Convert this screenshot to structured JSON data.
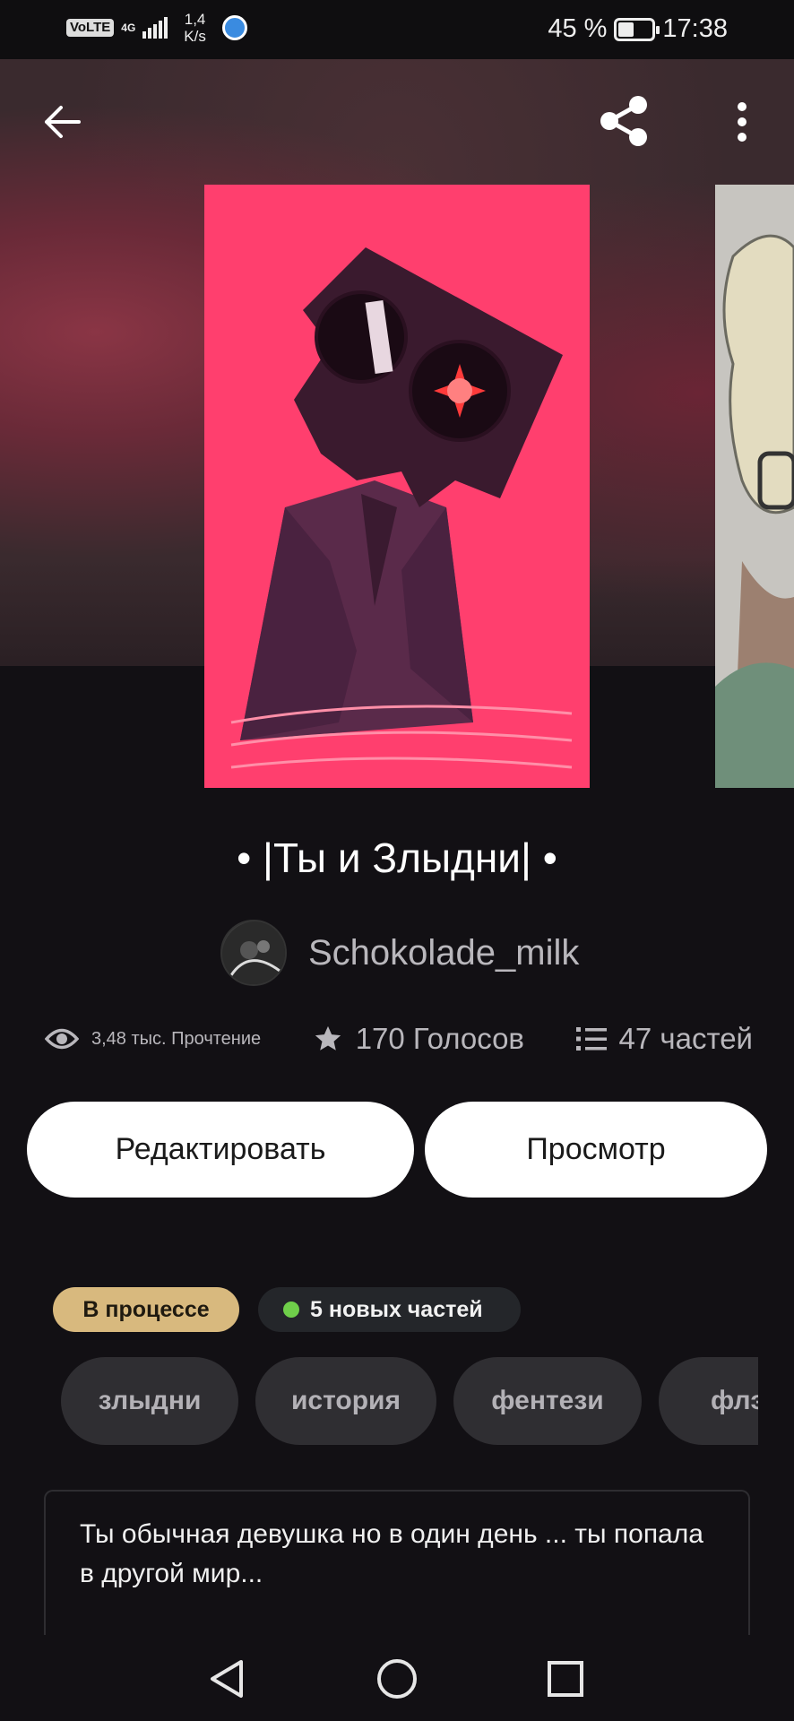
{
  "status_bar": {
    "network_badge": "VoLTE",
    "network_type": "4G",
    "speed_value": "1,4",
    "speed_unit": "K/s",
    "battery": "45 %",
    "battery_level": 0.45,
    "time": "17:38"
  },
  "header": {
    "back_icon": "arrow-left-icon",
    "share_icon": "share-icon",
    "more_icon": "more-vertical-icon"
  },
  "story": {
    "title": "• |Ты и Злыдни| •",
    "author": "Schokolade_milk"
  },
  "stats": {
    "reads": "3,48 тыс. Прочтение",
    "votes": "170 Голосов",
    "parts": "47 частей"
  },
  "actions": {
    "edit_label": "Редактировать",
    "view_label": "Просмотр"
  },
  "badges": {
    "status": "В процессе",
    "new_parts": "5 новых частей"
  },
  "tags": [
    "злыдни",
    "история",
    "фентези",
    "флэ"
  ],
  "description": {
    "text": "Ты обычная девушка но в один день ... ты попала в другой мир..."
  },
  "colors": {
    "background": "#121014",
    "cover_accent": "#ff3f6e",
    "status_badge": "#d8b97e",
    "new_dot": "#6fcf4a"
  },
  "navbar": {
    "back_icon": "triangle-back-icon",
    "home_icon": "circle-home-icon",
    "recents_icon": "square-recents-icon"
  }
}
